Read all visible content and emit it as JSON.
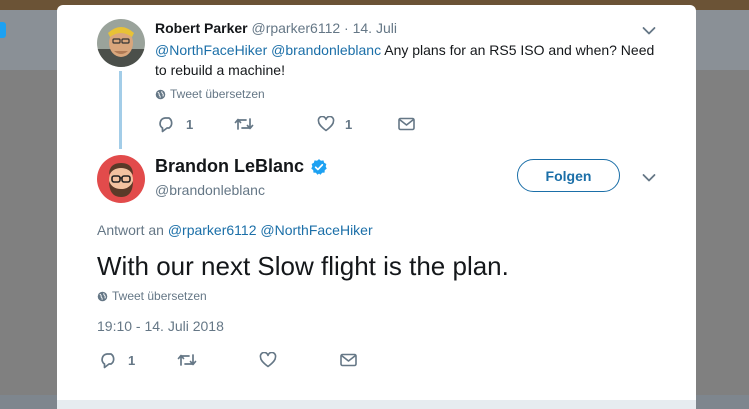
{
  "parent_tweet": {
    "author_name": "Robert Parker",
    "author_handle": "@rparker6112",
    "separator": "·",
    "date": "14. Juli",
    "mention_1": "@NorthFaceHiker",
    "mention_2": "@brandonleblanc",
    "text": " Any plans for an RS5 ISO and when? Need to rebuild a machine!",
    "translate_label": "Tweet übersetzen",
    "reply_count": "1",
    "retweet_count": "",
    "like_count": "1"
  },
  "main_tweet": {
    "author_name": "Brandon LeBlanc",
    "author_handle": "@brandonleblanc",
    "verified": true,
    "follow_label": "Folgen",
    "reply_prefix": "Antwort an",
    "reply_to_1": "@rparker6112",
    "reply_to_2": "@NorthFaceHiker",
    "text": "With our next Slow flight is the plan.",
    "translate_label": "Tweet übersetzen",
    "timestamp": "19:10 - 14. Juli 2018",
    "reply_count": "1",
    "retweet_count": "",
    "like_count": ""
  },
  "colors": {
    "accent": "#1da1f2",
    "link": "#1b6fa8",
    "muted": "#657786",
    "text": "#14171a"
  }
}
